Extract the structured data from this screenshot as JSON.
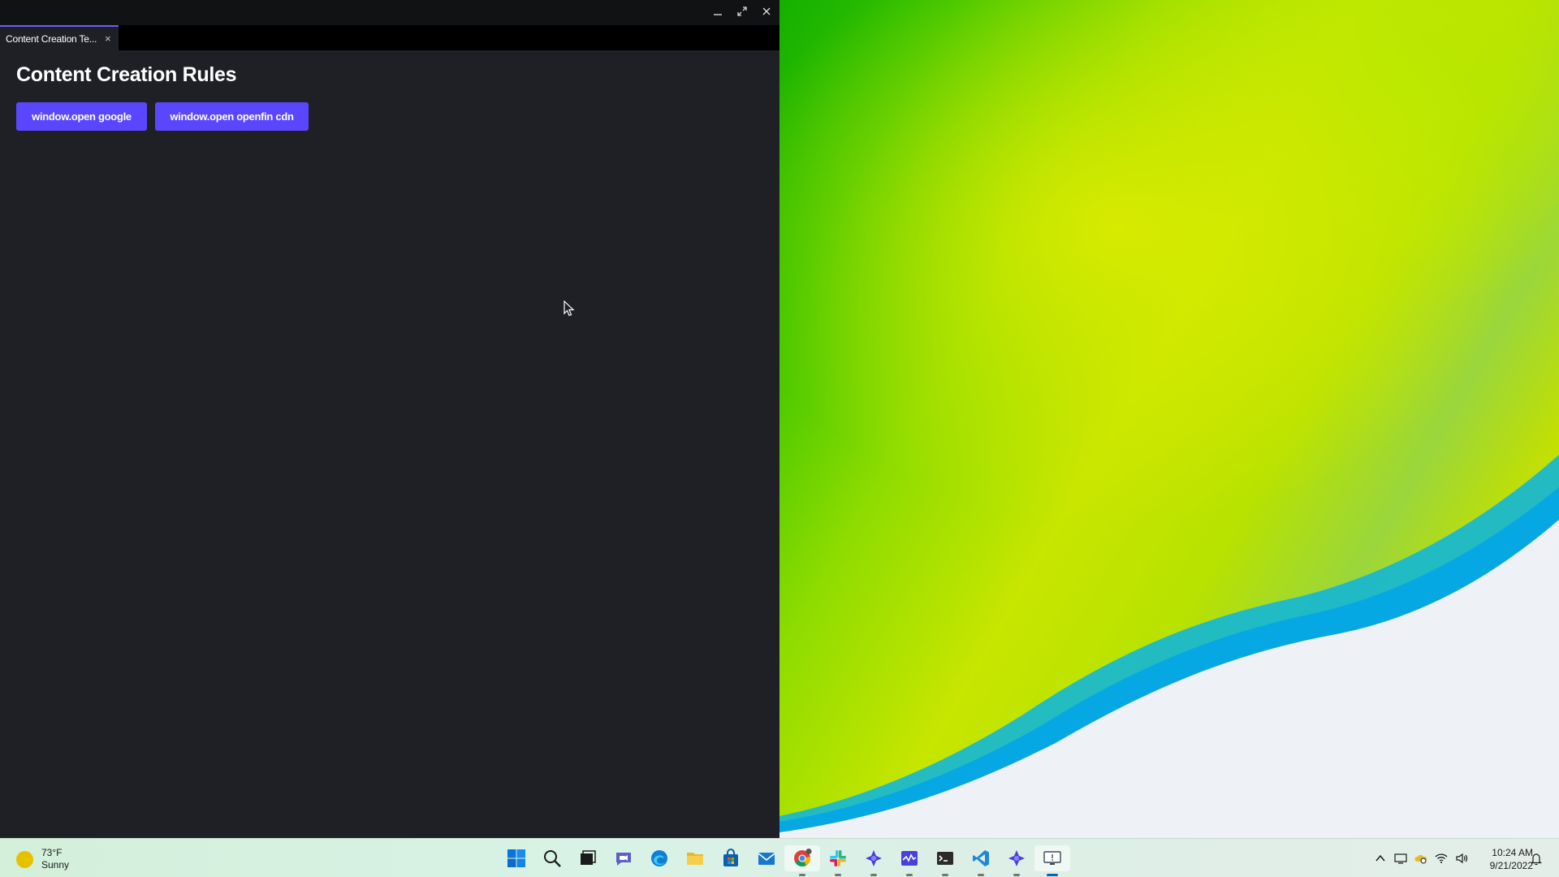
{
  "window": {
    "tab_label": "Content Creation Te...",
    "tab_close": "×",
    "page_title": "Content Creation Rules",
    "buttons": {
      "google": "window.open google",
      "cdn": "window.open openfin cdn"
    }
  },
  "colors": {
    "accent": "#5a46ff",
    "tab_underline": "#6b5cff",
    "window_bg": "#1e2026"
  },
  "taskbar": {
    "weather": {
      "temp": "73°F",
      "condition": "Sunny",
      "icon": "sun-icon"
    },
    "apps": [
      "windows-start-icon",
      "search-icon",
      "task-view-icon",
      "teams-chat-icon",
      "edge-icon",
      "file-explorer-icon",
      "store-icon",
      "mail-icon",
      "chrome-icon",
      "slack-icon",
      "openfin-icon",
      "process-manager-icon",
      "terminal-icon",
      "vscode-icon",
      "openfin-icon",
      "remote-desktop-icon"
    ],
    "tray": [
      "chevron-up-icon",
      "display-icon",
      "onedrive-icon",
      "wifi-icon",
      "volume-icon"
    ],
    "clock": {
      "time": "10:24 AM",
      "date": "9/21/2022"
    }
  }
}
